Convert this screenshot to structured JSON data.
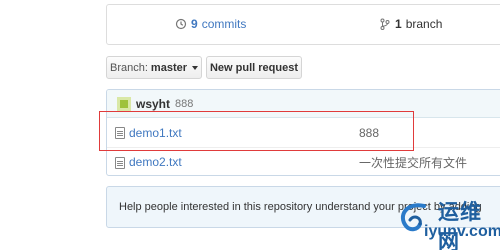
{
  "summary": {
    "commits_count": "9",
    "commits_label": "commits",
    "branch_count": "1",
    "branch_label": "branch"
  },
  "toolbar": {
    "branch_prefix": "Branch:",
    "branch_name": "master",
    "new_pr_label": "New pull request"
  },
  "latest_commit": {
    "author": "wsyht",
    "hash": "888"
  },
  "files": [
    {
      "name": "demo1.txt",
      "message": "888"
    },
    {
      "name": "demo2.txt",
      "message": "一次性提交所有文件"
    }
  ],
  "help_text": "Help people interested in this repository understand your project by adding",
  "watermark": {
    "cn": "运维网",
    "en": "iyunv.com"
  },
  "colors": {
    "link": "#4078c0",
    "highlight": "#e03b3b",
    "watermark": "#1f5f9f"
  }
}
